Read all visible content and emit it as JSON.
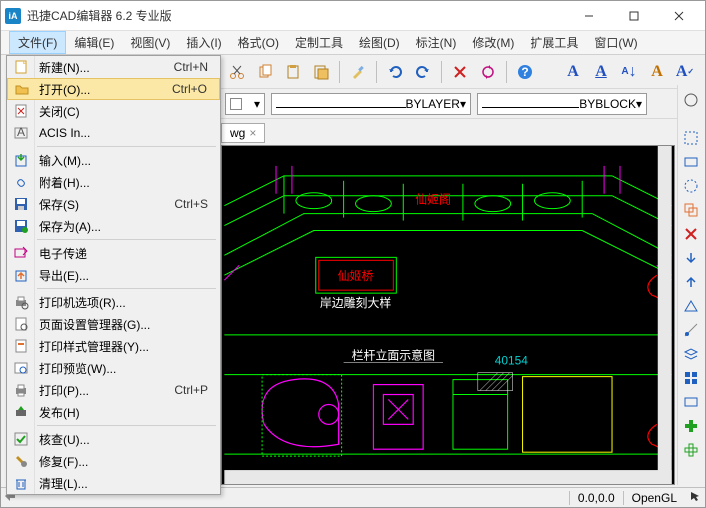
{
  "title": "迅捷CAD编辑器 6.2 专业版",
  "menubar": {
    "file": "文件(F)",
    "edit": "编辑(E)",
    "view": "视图(V)",
    "insert": "插入(I)",
    "format": "格式(O)",
    "tools": "定制工具",
    "draw": "绘图(D)",
    "annotate": "标注(N)",
    "modify": "修改(M)",
    "extend": "扩展工具",
    "window": "窗口(W)"
  },
  "file_menu": [
    {
      "icon": "new",
      "label": "新建(N)...",
      "shortcut": "Ctrl+N"
    },
    {
      "icon": "open",
      "label": "打开(O)...",
      "shortcut": "Ctrl+O",
      "highlight": true
    },
    {
      "icon": "close",
      "label": "关闭(C)"
    },
    {
      "icon": "acis",
      "label": "ACIS In..."
    },
    {
      "sep": true
    },
    {
      "icon": "import",
      "label": "输入(M)..."
    },
    {
      "icon": "attach",
      "label": "附着(H)..."
    },
    {
      "icon": "save",
      "label": "保存(S)",
      "shortcut": "Ctrl+S"
    },
    {
      "icon": "saveas",
      "label": "保存为(A)..."
    },
    {
      "sep": true
    },
    {
      "icon": "etransmit",
      "label": "电子传递"
    },
    {
      "icon": "export",
      "label": "导出(E)..."
    },
    {
      "sep": true
    },
    {
      "icon": "printopt",
      "label": "打印机选项(R)..."
    },
    {
      "icon": "pagesetup",
      "label": "页面设置管理器(G)..."
    },
    {
      "icon": "plotstyle",
      "label": "打印样式管理器(Y)..."
    },
    {
      "icon": "preview",
      "label": "打印预览(W)..."
    },
    {
      "icon": "print",
      "label": "打印(P)...",
      "shortcut": "Ctrl+P"
    },
    {
      "icon": "publish",
      "label": "发布(H)"
    },
    {
      "sep": true
    },
    {
      "icon": "check",
      "label": "核查(U)..."
    },
    {
      "icon": "repair",
      "label": "修复(F)..."
    },
    {
      "icon": "purge",
      "label": "清理(L)..."
    }
  ],
  "props": {
    "layer": "BYLAYER",
    "block": "BYBLOCK"
  },
  "tab": {
    "suffix": "wg",
    "close": "×"
  },
  "cad_labels": {
    "red1": "仙姬阁",
    "red2": "仙姬桥",
    "white1": "岸边雕刻大样",
    "white2": "栏杆立面示意图",
    "annot": "40154"
  },
  "status": {
    "coords": "0.0,0.0",
    "renderer": "OpenGL"
  }
}
